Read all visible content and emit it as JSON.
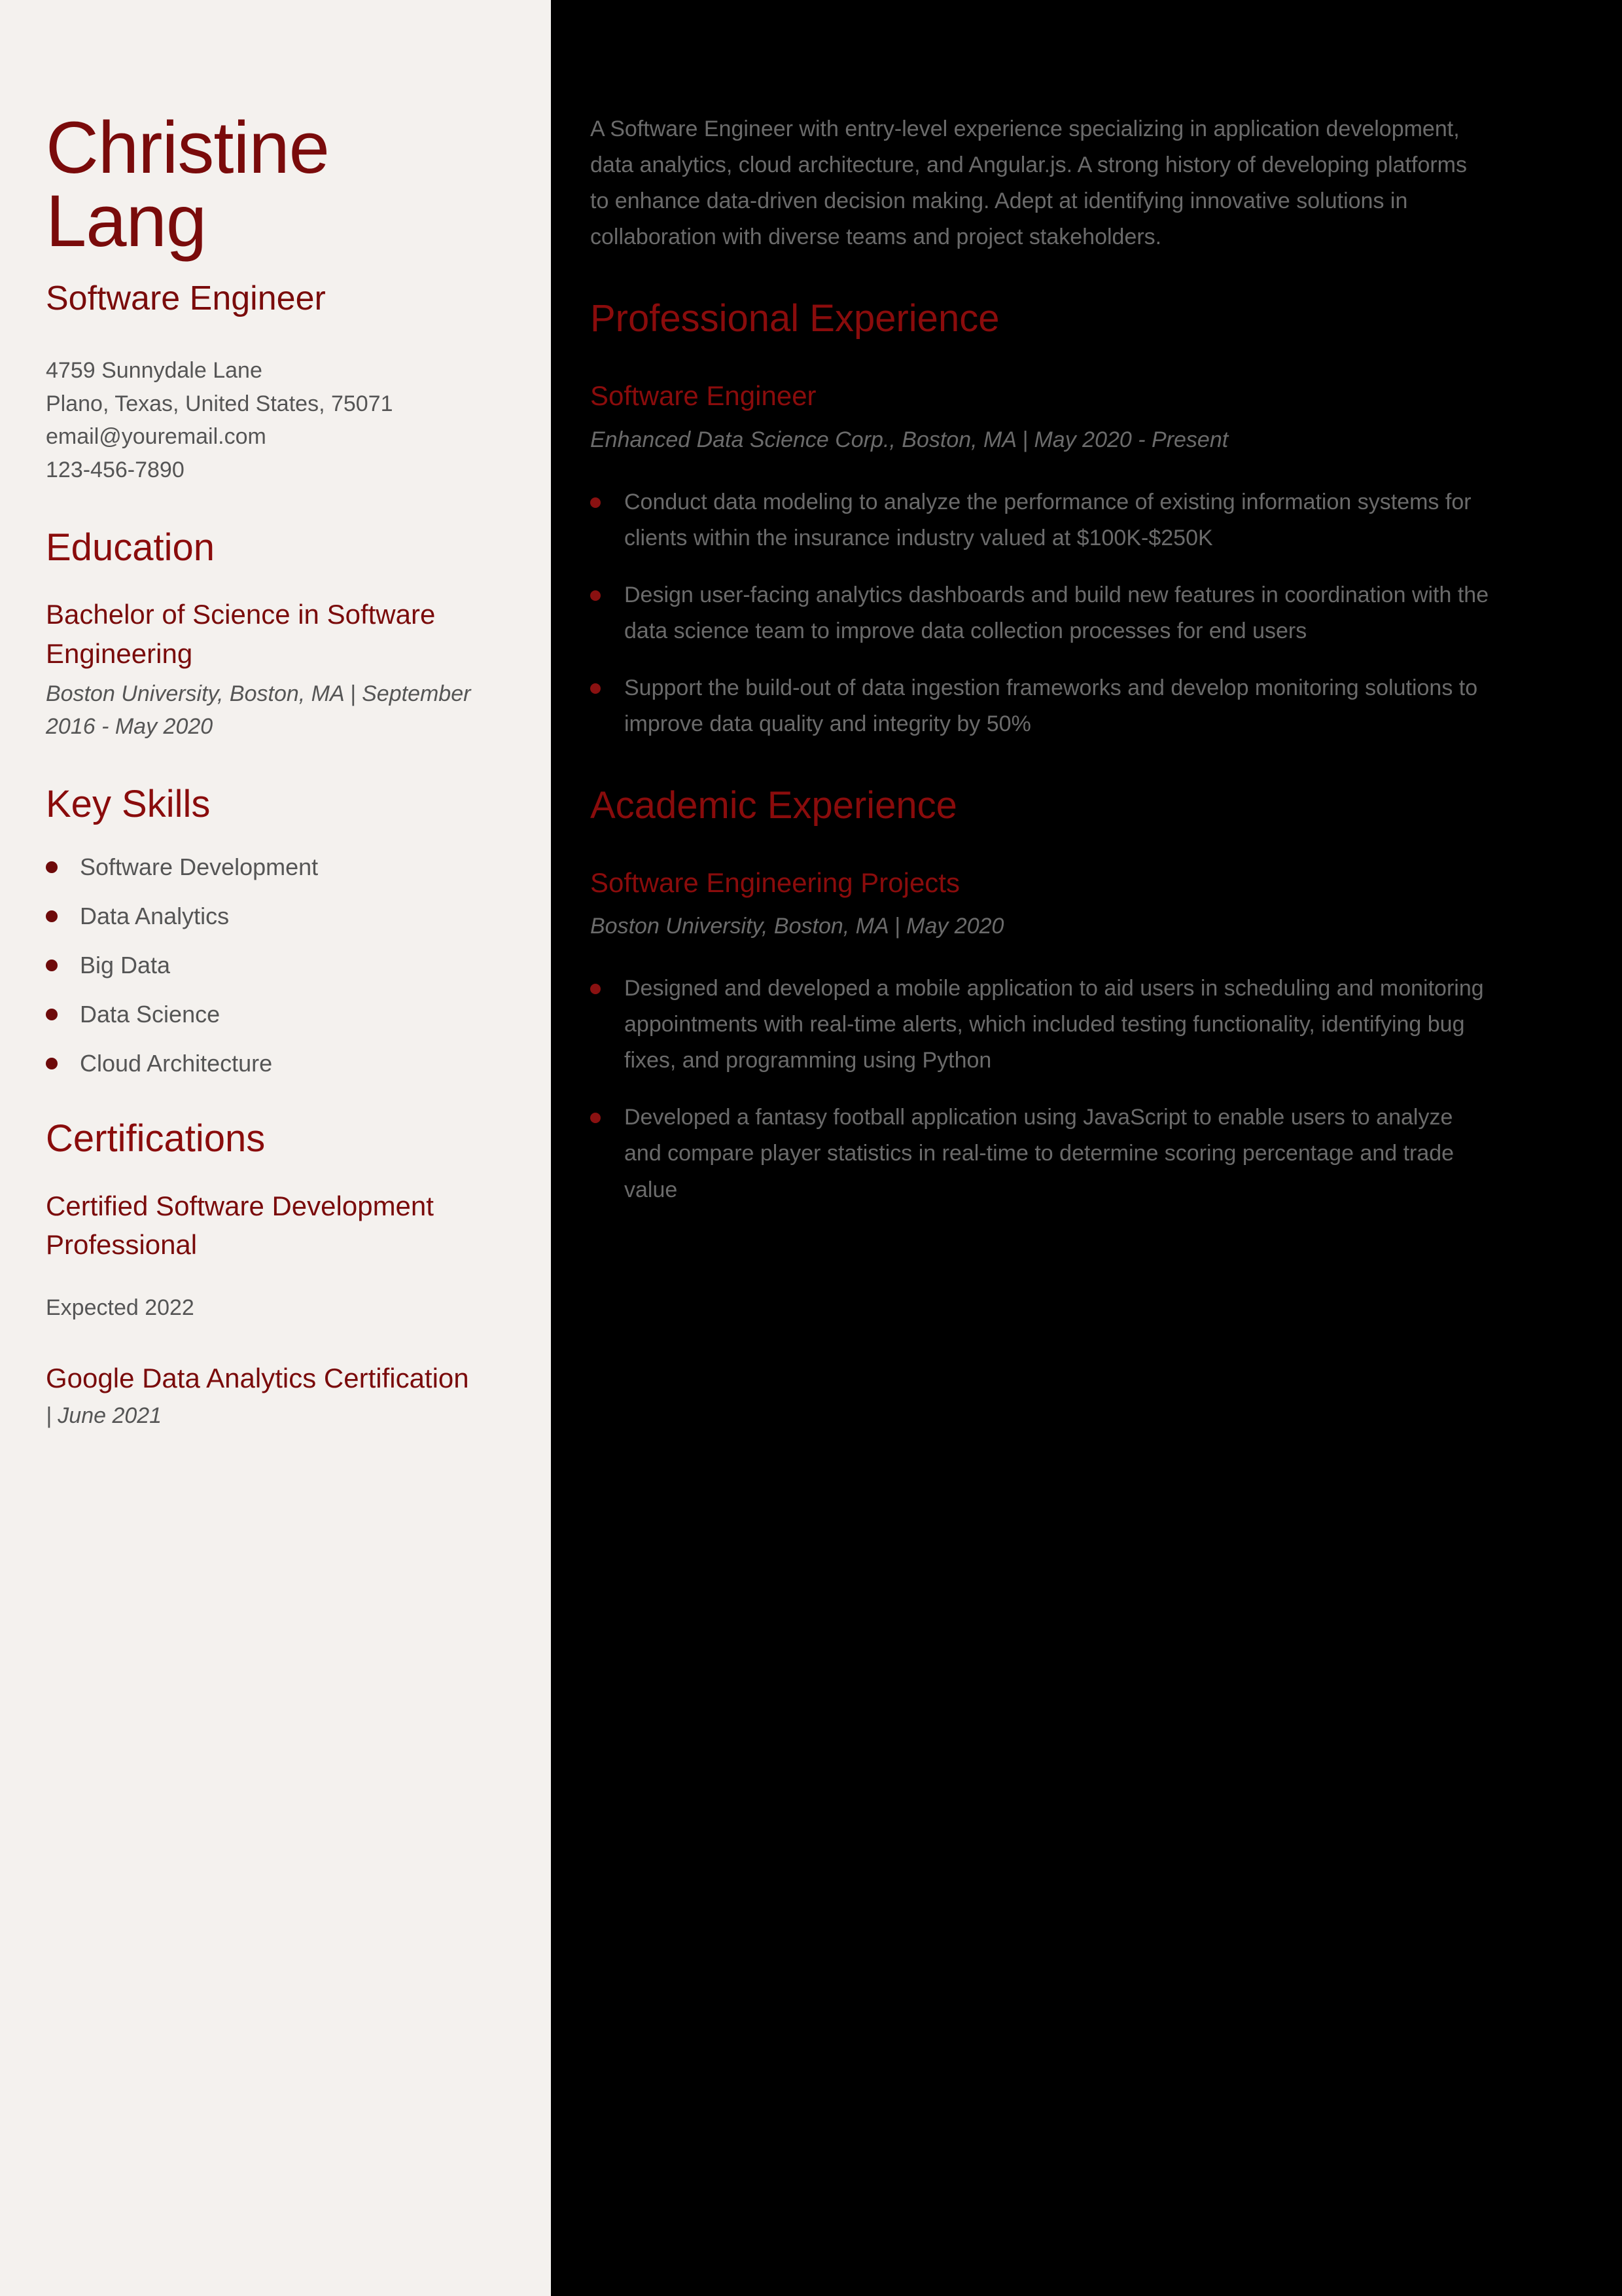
{
  "theme": {
    "left_background": "#F4F1EE",
    "right_background": "#000000",
    "accent_red": "#8A0C0C",
    "deep_maroon": "#7A0B0B",
    "body_gray_left": "#555555",
    "body_gray_right": "#6B6B6B"
  },
  "header": {
    "name": "Christine Lang",
    "job_title": "Software Engineer"
  },
  "contact": {
    "lines": [
      "4759 Sunnydale Lane",
      "Plano, Texas, United States, 75071",
      "email@youremail.com",
      "123-456-7890"
    ]
  },
  "education": {
    "heading": "Education",
    "entries": [
      {
        "degree": "Bachelor of Science in Software Engineering",
        "meta": "Boston University, Boston, MA | September 2016 - May 2020"
      }
    ]
  },
  "key_skills": {
    "heading": "Key Skills",
    "items": [
      "Software Development",
      "Data Analytics",
      "Big Data",
      "Data Science",
      "Cloud Architecture"
    ]
  },
  "certifications": {
    "heading": "Certifications",
    "entries": [
      {
        "name": "Certified Software Development Professional",
        "meta": "Expected 2022"
      },
      {
        "name": "Google Data Analytics Certification",
        "meta": "| June 2021"
      }
    ]
  },
  "summary": {
    "text": "A Software Engineer with entry-level experience specializing in   application development, data analytics, cloud architecture, and   Angular.js. A strong history of developing platforms to enhance   data-driven decision making. Adept at identifying innovative solutions   in collaboration with diverse teams and project stakeholders."
  },
  "professional_experience": {
    "heading": "Professional Experience",
    "roles": [
      {
        "title": "Software Engineer",
        "meta": "Enhanced Data Science Corp., Boston, MA | May 2020 - Present",
        "duties": [
          "Conduct data modeling to analyze the performance of existing   information systems for clients within the insurance industry valued at   $100K-$250K",
          "Design user-facing analytics dashboards and build new features in    coordination with the data science team to improve data collection   processes for end users",
          "Support the build-out of data ingestion frameworks and develop monitoring solutions to improve data quality and integrity by 50%"
        ]
      }
    ]
  },
  "academic_experience": {
    "heading": "Academic Experience",
    "roles": [
      {
        "title": "Software Engineering Projects",
        "meta": "Boston University, Boston, MA | May 2020",
        "duties": [
          "Designed and developed a mobile application to aid users in   scheduling and monitoring appointments with real-time alerts, which   included testing functionality, identifying bug fixes, and programming   using Python",
          "Developed a fantasy football application using JavaScript to enable   users to analyze and compare player statistics in real-time to determine   scoring percentage and trade value"
        ]
      }
    ]
  }
}
